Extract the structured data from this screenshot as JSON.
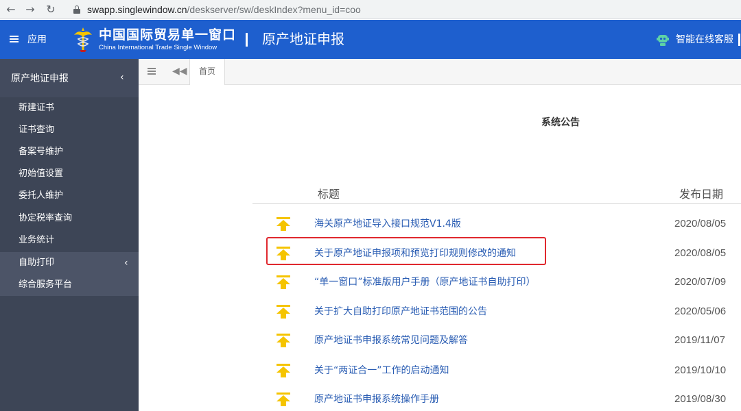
{
  "browser": {
    "url_host": "swapp.singlewindow.cn",
    "url_path": "/deskserver/sw/deskIndex?menu_id=coo"
  },
  "header": {
    "app_label": "应用",
    "brand_cn": "中国国际贸易单一窗口",
    "brand_en": "China International Trade Single Window",
    "page_heading": "原产地证申报",
    "service_label": "智能在线客服",
    "accent_color": "#1e5fce"
  },
  "sidebar": {
    "header_label": "原产地证申报",
    "items": [
      {
        "label": "新建证书"
      },
      {
        "label": "证书查询"
      },
      {
        "label": "备案号维护"
      },
      {
        "label": "初始值设置"
      },
      {
        "label": "委托人维护"
      },
      {
        "label": "协定税率查询"
      },
      {
        "label": "业务统计"
      },
      {
        "label": "自助打印"
      },
      {
        "label": "综合服务平台"
      }
    ]
  },
  "tabs": {
    "home_label": "首页"
  },
  "notices": {
    "section_title": "系统公告",
    "col_title": "标题",
    "col_date": "发布日期",
    "rows": [
      {
        "title": "海关原产地证导入接口规范V1.4版",
        "date": "2020/08/05"
      },
      {
        "title": "关于原产地证申报项和预览打印规则修改的通知",
        "date": "2020/08/05"
      },
      {
        "title": "“单一窗口”标准版用户手册（原产地证书自助打印）",
        "date": "2020/07/09"
      },
      {
        "title": "关于扩大自助打印原产地证书范围的公告",
        "date": "2020/05/06"
      },
      {
        "title": "原产地证书申报系统常见问题及解答",
        "date": "2019/11/07"
      },
      {
        "title": "关于“两证合一”工作的启动通知",
        "date": "2019/10/10"
      },
      {
        "title": "原产地证书申报系统操作手册",
        "date": "2019/08/30"
      }
    ]
  },
  "colors": {
    "link": "#2a5db3",
    "sidebar_bg": "#3d4556",
    "highlight": "#e0282e",
    "notice_icon": "#f5c400"
  }
}
